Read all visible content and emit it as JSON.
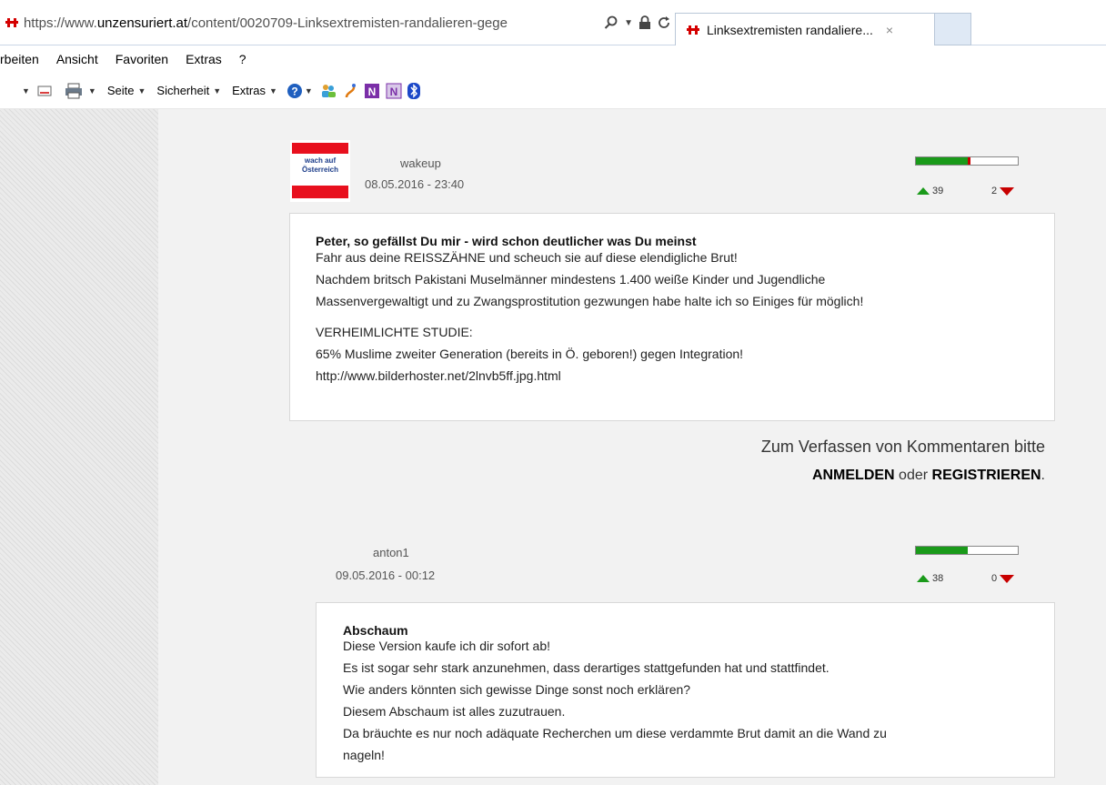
{
  "browser": {
    "url_prefix": "https://www.",
    "url_domain": "unzensuriert.at",
    "url_path": "/content/0020709-Linksextremisten-randalieren-gege",
    "tab_title": "Linksextremisten randaliere...",
    "tab_close": "×",
    "addr_icons": [
      "search-icon",
      "dropdown-icon",
      "lock-icon",
      "refresh-icon"
    ]
  },
  "menubar": {
    "items": [
      "rbeiten",
      "Ansicht",
      "Favoriten",
      "Extras",
      "?"
    ]
  },
  "cmdbar": {
    "page_label": "Seite",
    "security_label": "Sicherheit",
    "extras_label": "Extras"
  },
  "comments": [
    {
      "author": "wakeup",
      "date": "08.05.2016 - 23:40",
      "avatar_text_1": "wach auf",
      "avatar_text_2": "Österreich",
      "up": "39",
      "down": "2",
      "rating_fraction": 0.51,
      "neg_fraction": 0.03,
      "title": "Peter, so gefällst Du mir - wird schon deutlicher was Du meinst",
      "lines": [
        "Fahr aus deine REISSZÄHNE und scheuch sie auf diese elendigliche Brut!",
        "Nachdem britsch Pakistani Muselmänner mindestens 1.400 weiße Kinder und Jugendliche",
        "Massenvergewaltigt und zu Zwangsprostitution gezwungen habe halte ich so Einiges für möglich!"
      ],
      "lines2": [
        "VERHEIMLICHTE STUDIE:",
        "65% Muslime zweiter Generation (bereits in Ö. geboren!) gegen Integration!",
        "http://www.bilderhoster.net/2lnvb5ff.jpg.html"
      ]
    },
    {
      "author": "anton1",
      "date": "09.05.2016 - 00:12",
      "up": "38",
      "down": "0",
      "rating_fraction": 0.51,
      "title": "Abschaum",
      "lines": [
        "Diese Version kaufe ich dir sofort ab!",
        "Es ist sogar sehr stark anzunehmen, dass derartiges stattgefunden hat und stattfindet.",
        "Wie anders könnten sich gewisse Dinge sonst noch erklären?",
        "Diesem Abschaum ist alles zuzutrauen.",
        "Da bräuchte es nur noch adäquate Recherchen um diese verdammte Brut damit an die Wand zu",
        "nageln!"
      ]
    }
  ],
  "login_note": {
    "line1": "Zum Verfassen von Kommentaren bitte",
    "login": "ANMELDEN",
    "or": " oder ",
    "register": "REGISTRIEREN",
    "period": "."
  },
  "colors": {
    "positive": "#1a9a1a",
    "negative": "#c80000",
    "brand_red": "#d40000"
  }
}
